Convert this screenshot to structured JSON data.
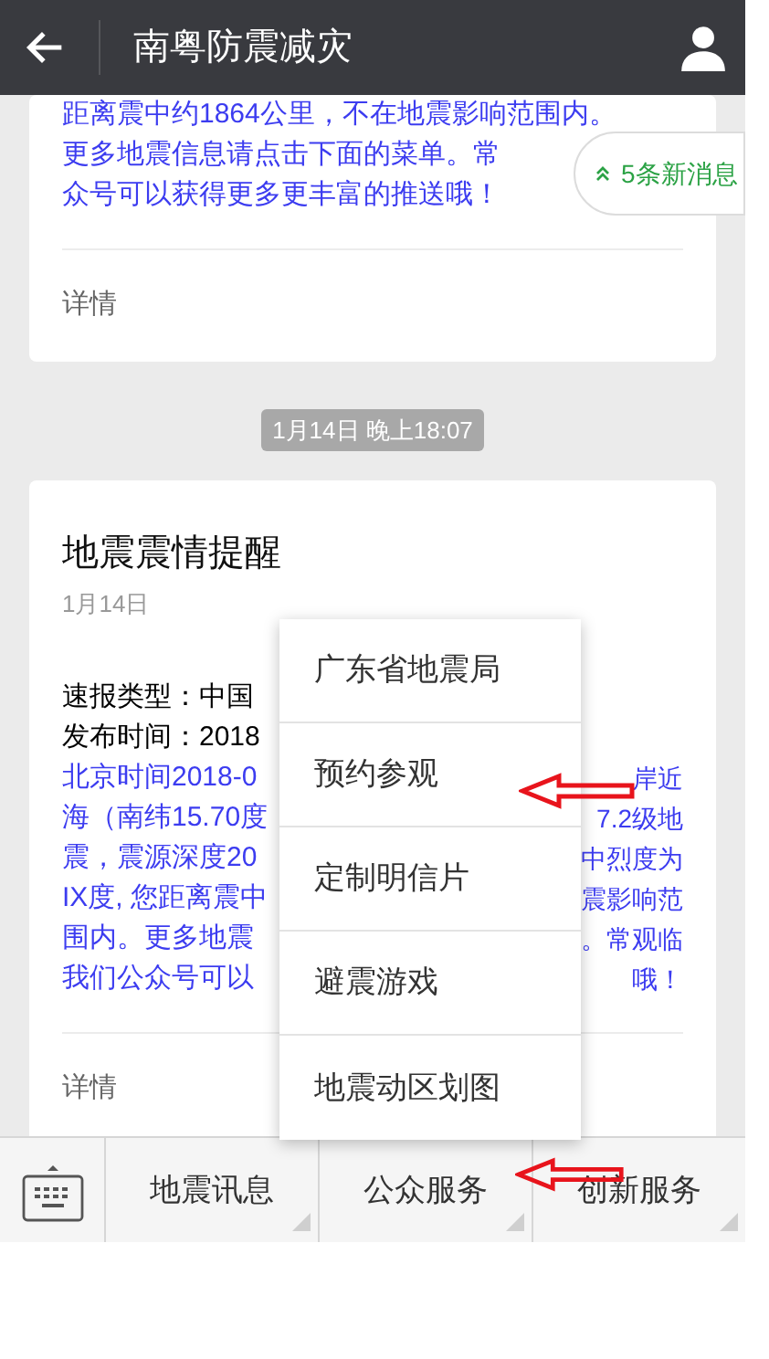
{
  "header": {
    "title": "南粤防震减灾"
  },
  "new_messages": {
    "label": "5条新消息"
  },
  "cards": [
    {
      "body_lines": [
        {
          "left": "距离震中约1864公里，不在地震影响范围内。"
        },
        {
          "left": "更多地震信息请点击下面的菜单。常"
        },
        {
          "left": "众号可以获得更多更丰富的推送哦！"
        }
      ],
      "link": "详情"
    },
    {
      "timestamp": "1月14日 晚上18:07",
      "title": "地震震情提醒",
      "date": "1月14日",
      "info_lines": [
        "速报类型：中国",
        "发布时间：2018"
      ],
      "body_lines": [
        {
          "left": "北京时间2018-0",
          "right": "岸近"
        },
        {
          "left": "海（南纬15.70度",
          "right": "7.2级地"
        },
        {
          "left": "震，震源深度20",
          "right": "中烈度为"
        },
        {
          "left": "IX度, 您距离震中",
          "right": "震影响范"
        },
        {
          "left": "围内。更多地震",
          "right": "。常观临"
        },
        {
          "left": "我们公众号可以",
          "right": "哦！"
        }
      ],
      "link": "详情"
    }
  ],
  "popup_menu": {
    "items": [
      "广东省地震局",
      "预约参观",
      "定制明信片",
      "避震游戏",
      "地震动区划图"
    ]
  },
  "bottom_menu": {
    "items": [
      "地震讯息",
      "公众服务",
      "创新服务"
    ]
  }
}
